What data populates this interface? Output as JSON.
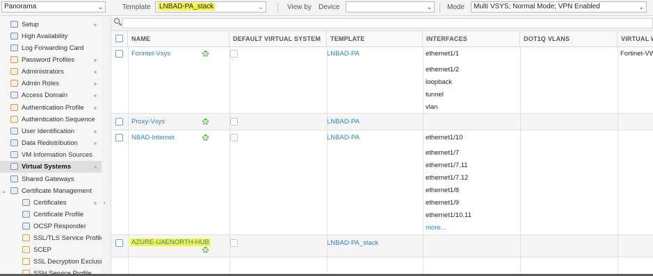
{
  "context_select": {
    "value": "Panorama"
  },
  "template": {
    "label": "Template",
    "value": "LNBAD-PA_stack"
  },
  "view_by": {
    "label": "View by",
    "value": "Device",
    "select_value": ""
  },
  "mode": {
    "label": "Mode",
    "value": "Multi VSYS; Normal Mode; VPN Enabled"
  },
  "sidebar": {
    "items": [
      {
        "label": "Setup",
        "icon": "setup-icon"
      },
      {
        "label": "High Availability",
        "icon": "high-availability-icon"
      },
      {
        "label": "Log Forwarding Card",
        "icon": "log-forwarding-card-icon"
      },
      {
        "label": "Password Profiles",
        "icon": "password-profiles-icon"
      },
      {
        "label": "Administrators",
        "icon": "administrators-icon"
      },
      {
        "label": "Admin Roles",
        "icon": "admin-roles-icon"
      },
      {
        "label": "Access Domain",
        "icon": "access-domain-icon"
      },
      {
        "label": "Authentication Profile",
        "icon": "authentication-profile-icon"
      },
      {
        "label": "Authentication Sequence",
        "icon": "authentication-sequence-icon"
      },
      {
        "label": "User Identification",
        "icon": "user-identification-icon"
      },
      {
        "label": "Data Redistribution",
        "icon": "data-redistribution-icon"
      },
      {
        "label": "VM Information Sources",
        "icon": "vm-information-sources-icon"
      },
      {
        "label": "Virtual Systems",
        "icon": "virtual-systems-icon",
        "selected": true
      },
      {
        "label": "Shared Gateways",
        "icon": "shared-gateways-icon"
      },
      {
        "label": "Certificate Management",
        "icon": "certificate-management-icon"
      },
      {
        "label": "Certificates",
        "icon": "certificates-icon"
      },
      {
        "label": "Certificate Profile",
        "icon": "certificate-profile-icon"
      },
      {
        "label": "OCSP Responder",
        "icon": "ocsp-responder-icon"
      },
      {
        "label": "SSL/TLS Service Profile",
        "icon": "lock-icon"
      },
      {
        "label": "SCEP",
        "icon": "lock-icon"
      },
      {
        "label": "SSL Decryption Exclusion",
        "icon": "lock-icon"
      },
      {
        "label": "SSH Service Profile",
        "icon": "lock-icon"
      }
    ]
  },
  "table": {
    "columns": [
      "NAME",
      "DEFAULT VIRTUAL SYSTEM",
      "TEMPLATE",
      "INTERFACES",
      "DOT1Q VLANS",
      "VIRTUAL W"
    ],
    "rows": [
      {
        "name": "Forintet-Vsys",
        "template": "LNBAD-PA",
        "interfaces": [
          "ethernet1/1",
          "ethernet1/2",
          "loopback",
          "tunnel",
          "vlan"
        ],
        "virtual_wire": "Fortinet-VW"
      },
      {
        "name": "Proxy-Vsys",
        "template": "LNBAD-PA",
        "interfaces": [],
        "virtual_wire": ""
      },
      {
        "name": "NBAD-Internet",
        "template": "LNBAD-PA",
        "interfaces": [
          "ethernet1/10",
          "ethernet1/7",
          "ethernet1/7.11",
          "ethernet1/7.12",
          "ethernet1/8",
          "ethernet1/9",
          "ethernet1/10.11"
        ],
        "more": "more...",
        "virtual_wire": ""
      },
      {
        "name": "AZURE-UAENORTH-HUB",
        "template": "LNBAD-PA_stack",
        "interfaces": [],
        "virtual_wire": ""
      }
    ]
  },
  "colors": {
    "link": "#2b7fc1",
    "highlight": "#f5f53d",
    "selected_nav": "#dedede"
  }
}
